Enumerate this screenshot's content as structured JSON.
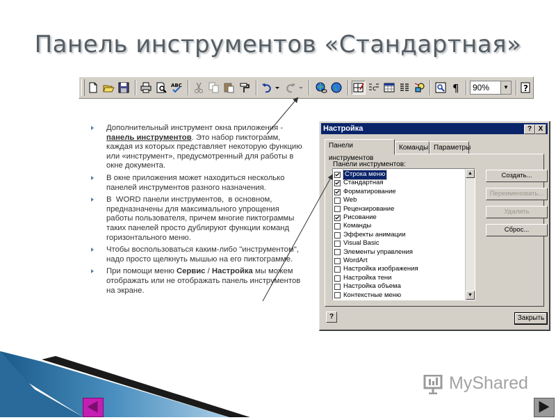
{
  "slide": {
    "title": "Панель инструментов «Стандартная»"
  },
  "toolbar": {
    "zoom_value": "90%",
    "icons": [
      "new-icon",
      "open-icon",
      "save-icon",
      "print-icon",
      "preview-icon",
      "spelling-icon",
      "cut-icon",
      "copy-icon",
      "paste-icon",
      "format-painter-icon",
      "undo-icon",
      "redo-icon",
      "hyperlink-icon",
      "web-icon",
      "tables-borders-icon",
      "insert-table-icon",
      "insert-excel-icon",
      "columns-icon",
      "drawing-icon",
      "document-map-icon",
      "show-hide-icon",
      "help-icon"
    ]
  },
  "bullets": {
    "b1_pre": "Дополнительный инструмент окна приложения - ",
    "b1_link": "панель инструментов",
    "b1_post": ". Это набор пиктограмм, каждая из которых представляет некоторую функцию или «инструмент», предусмотренный для работы в окне документа.",
    "b2": "В окне приложения может находиться несколько панелей инструментов разного назначения.",
    "b3": "В  WORD панели инструментов,  в основном, предназначены для максимального упрощения работы пользователя, причем многие пиктограммы таких панелей просто дублируют функции команд горизонтального меню.",
    "b4": "Чтобы воспользоваться каким-либо \"инструментом\", надо просто щелкнуть мышью на его пиктограмме.",
    "b5_pre": "При помощи меню ",
    "b5_bold1": "Сервис",
    "b5_mid": " / ",
    "b5_bold2": "Настройка",
    "b5_post": " мы можем отображать или не отображать панель инструментов на экране."
  },
  "dialog": {
    "title": "Настройка",
    "help_glyph": "?",
    "close_glyph": "X",
    "tabs": [
      "Панели инструментов",
      "Команды",
      "Параметры"
    ],
    "list_label": "Панели инструментов:",
    "items": [
      {
        "label": "Строка меню",
        "checked": true,
        "selected": true
      },
      {
        "label": "Стандартная",
        "checked": true,
        "selected": false
      },
      {
        "label": "Форматирование",
        "checked": true,
        "selected": false
      },
      {
        "label": "Web",
        "checked": false,
        "selected": false
      },
      {
        "label": "Рецензирование",
        "checked": false,
        "selected": false
      },
      {
        "label": "Рисование",
        "checked": true,
        "selected": false
      },
      {
        "label": "Команды",
        "checked": false,
        "selected": false
      },
      {
        "label": "Эффекты анимации",
        "checked": false,
        "selected": false
      },
      {
        "label": "Visual Basic",
        "checked": false,
        "selected": false
      },
      {
        "label": "Элементы управления",
        "checked": false,
        "selected": false
      },
      {
        "label": "WordArt",
        "checked": false,
        "selected": false
      },
      {
        "label": "Настройка изображения",
        "checked": false,
        "selected": false
      },
      {
        "label": "Настройка тени",
        "checked": false,
        "selected": false
      },
      {
        "label": "Настройка объема",
        "checked": false,
        "selected": false
      },
      {
        "label": "Контекстные меню",
        "checked": false,
        "selected": false
      }
    ],
    "buttons": {
      "create": "Создать...",
      "rename": "Переименовать...",
      "delete": "Удалить",
      "reset": "Сброс..."
    },
    "footer_help": "?",
    "footer_close": "Закрыть"
  },
  "branding": {
    "logo_text": "MyShared"
  },
  "colors": {
    "title_bar": "#0a246a",
    "bullet_marker": "#5a7fa8",
    "nav_prev": "#c41eb2"
  }
}
